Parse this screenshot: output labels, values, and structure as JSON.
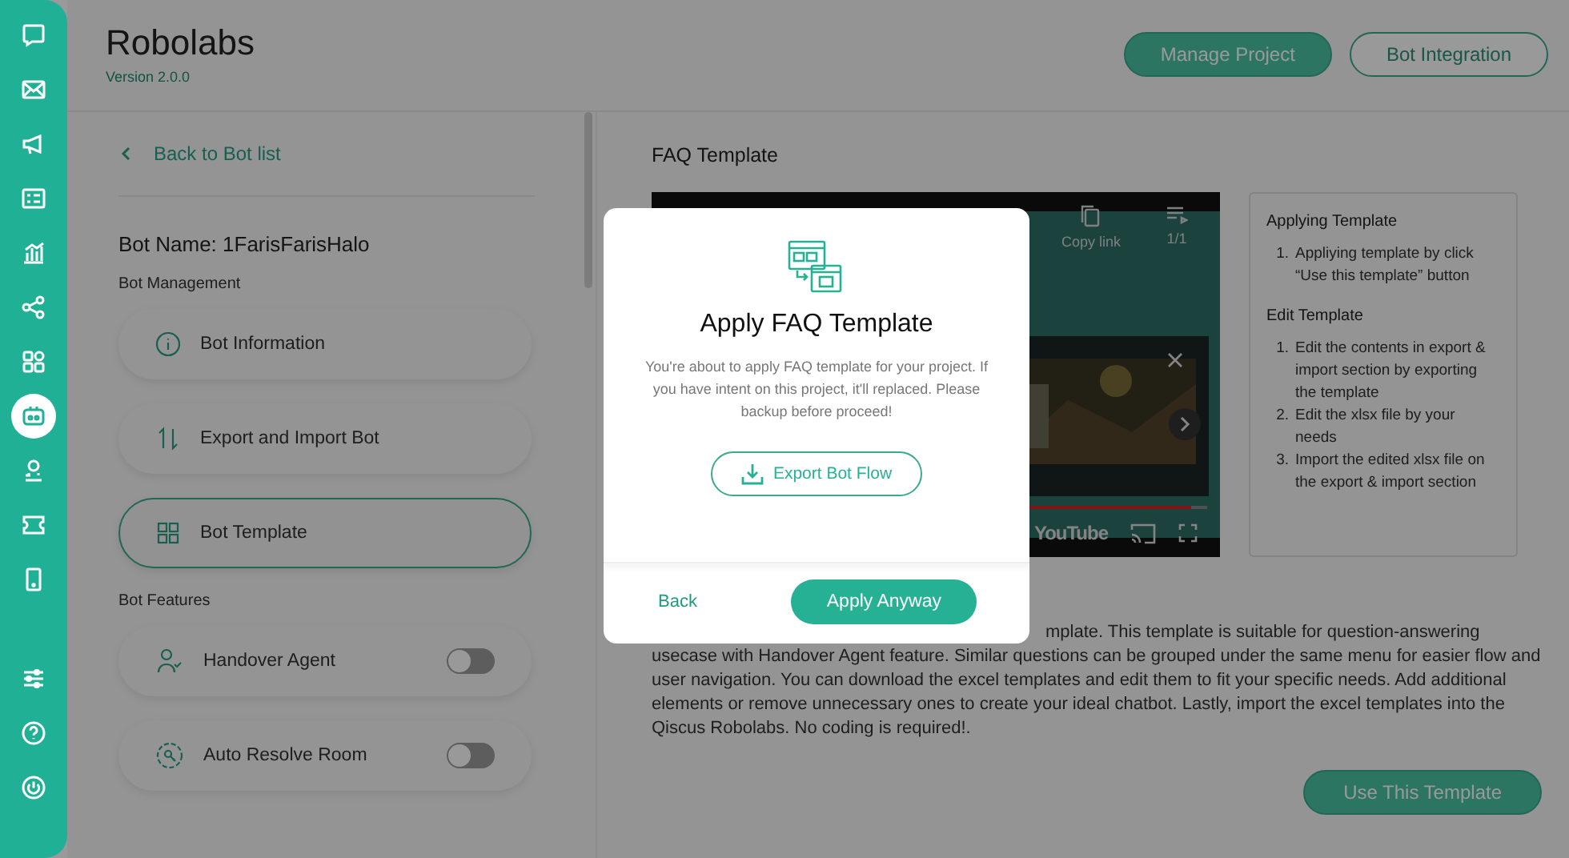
{
  "sidebar": {
    "top_items": [
      {
        "selected": false
      },
      {
        "selected": false
      },
      {
        "selected": false
      },
      {
        "selected": false
      },
      {
        "selected": false
      },
      {
        "selected": false
      },
      {
        "selected": false
      },
      {
        "selected": true
      },
      {
        "selected": false
      },
      {
        "selected": false
      },
      {
        "selected": false
      }
    ],
    "bottom_items": [
      {
        "selected": false
      },
      {
        "selected": false
      },
      {
        "selected": false
      }
    ]
  },
  "header": {
    "title": "Robolabs",
    "version": "Version 2.0.0",
    "buttons": [
      {
        "label": "Manage Project",
        "kind": "primary"
      },
      {
        "label": "Bot Integration",
        "kind": "outline"
      }
    ]
  },
  "left_panel": {
    "back_link": "Back to Bot list",
    "bot_name": "Bot Name: 1FarisFarisHalo",
    "management_title": "Bot Management",
    "management_items": [
      {
        "label": "Bot Information",
        "selected": false
      },
      {
        "label": "Export and Import Bot",
        "selected": false
      },
      {
        "label": "Bot Template",
        "selected": true
      }
    ],
    "features_title": "Bot Features",
    "features": [
      {
        "label": "Handover Agent",
        "on": false
      },
      {
        "label": "Auto Resolve Room",
        "on": false
      }
    ]
  },
  "template": {
    "title": "FAQ Template",
    "video": {
      "kind": "picture",
      "copy_link": "Copy link",
      "count": "1/1",
      "brand": "YouTube",
      "progress": {
        "level": 0.93
      }
    },
    "info": {
      "sections": [
        {
          "title": "Applying Template",
          "steps": [
            {
              "marker": "1.",
              "text": "Appliying template by click “Use this template” button"
            }
          ]
        },
        {
          "title": "Edit Template",
          "steps": [
            {
              "marker": "1.",
              "text": "Edit the contents in export & import section by exporting the template"
            },
            {
              "marker": "2.",
              "text": "Edit the xlsx file by your needs"
            },
            {
              "marker": "3.",
              "text": "Import the edited xlsx file on the export & import section"
            }
          ]
        }
      ]
    },
    "description": "mplate. This template is suitable for question-answering usecase with Handover Agent feature. Similar questions can be grouped under the same menu for easier flow and user navigation. You can download the excel templates and edit them to fit your specific needs. Add additional elements or remove unnecessary ones to create your ideal chatbot. Lastly, import the excel templates into the Qiscus Robolabs. No coding is required!.",
    "use_button": "Use This Template"
  },
  "modal": {
    "title": "Apply FAQ Template",
    "message": "You're about to apply FAQ template for your project. If you have intent on this project, it'll replaced. Please backup before proceed!",
    "export_button": "Export Bot Flow",
    "back_button": "Back",
    "apply_button": "Apply Anyway"
  }
}
